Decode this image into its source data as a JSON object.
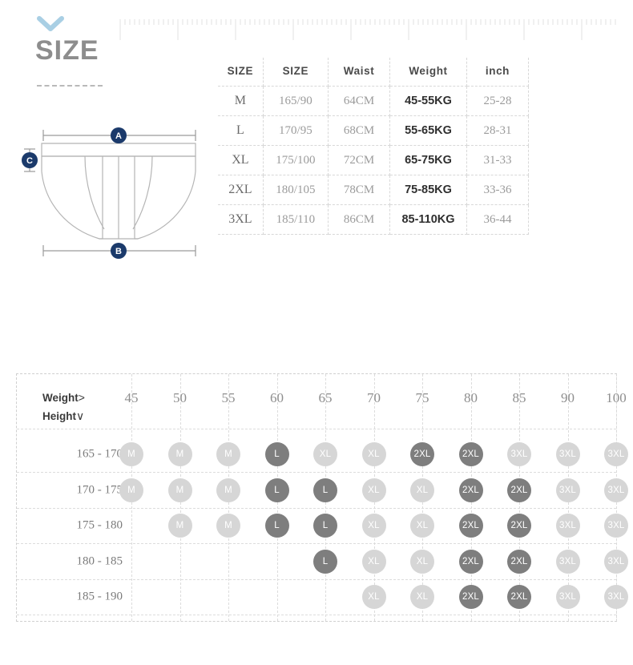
{
  "heading": {
    "title": "SIZE",
    "chevron_icon": "chevron-down-icon",
    "chevron_color": "#a9cfe4"
  },
  "diagram": {
    "name": "briefs-measurement-diagram",
    "badges": [
      {
        "id": "A",
        "label": "A",
        "position": "top-width"
      },
      {
        "id": "B",
        "label": "B",
        "position": "bottom-width"
      },
      {
        "id": "C",
        "label": "C",
        "position": "left-waistband-height"
      }
    ],
    "badge_color": "#1b3a6b",
    "outline_color": "#b9b9b9"
  },
  "spec_table": {
    "headers": [
      "SIZE",
      "SIZE",
      "Waist",
      "Weight",
      "inch"
    ],
    "rows": [
      {
        "size": "M",
        "size2": "165/90",
        "waist": "64CM",
        "weight": "45-55KG",
        "inch": "25-28"
      },
      {
        "size": "L",
        "size2": "170/95",
        "waist": "68CM",
        "weight": "55-65KG",
        "inch": "28-31"
      },
      {
        "size": "XL",
        "size2": "175/100",
        "waist": "72CM",
        "weight": "65-75KG",
        "inch": "31-33"
      },
      {
        "size": "2XL",
        "size2": "180/105",
        "waist": "78CM",
        "weight": "75-85KG",
        "inch": "33-36"
      },
      {
        "size": "3XL",
        "size2": "185/110",
        "waist": "86CM",
        "weight": "85-110KG",
        "inch": "36-44"
      }
    ]
  },
  "matrix": {
    "corner_label_top": "Weight",
    "corner_label_top_arrow": ">",
    "corner_label_bottom": "Height",
    "corner_label_bottom_arrow": "∨",
    "columns": [
      "45",
      "50",
      "55",
      "60",
      "65",
      "70",
      "75",
      "80",
      "85",
      "90",
      "100"
    ],
    "rows": [
      {
        "label": "165 - 170",
        "cells": [
          {
            "col": "45",
            "size": "M",
            "tone": "light"
          },
          {
            "col": "50",
            "size": "M",
            "tone": "light"
          },
          {
            "col": "55",
            "size": "M",
            "tone": "light"
          },
          {
            "col": "60",
            "size": "L",
            "tone": "dark"
          },
          {
            "col": "65",
            "size": "XL",
            "tone": "light"
          },
          {
            "col": "70",
            "size": "XL",
            "tone": "light"
          },
          {
            "col": "75",
            "size": "2XL",
            "tone": "dark"
          },
          {
            "col": "80",
            "size": "2XL",
            "tone": "dark"
          },
          {
            "col": "85",
            "size": "3XL",
            "tone": "light"
          },
          {
            "col": "90",
            "size": "3XL",
            "tone": "light"
          },
          {
            "col": "100",
            "size": "3XL",
            "tone": "light"
          }
        ]
      },
      {
        "label": "170 - 175",
        "cells": [
          {
            "col": "45",
            "size": "M",
            "tone": "light"
          },
          {
            "col": "50",
            "size": "M",
            "tone": "light"
          },
          {
            "col": "55",
            "size": "M",
            "tone": "light"
          },
          {
            "col": "60",
            "size": "L",
            "tone": "dark"
          },
          {
            "col": "65",
            "size": "L",
            "tone": "dark"
          },
          {
            "col": "70",
            "size": "XL",
            "tone": "light"
          },
          {
            "col": "75",
            "size": "XL",
            "tone": "light"
          },
          {
            "col": "80",
            "size": "2XL",
            "tone": "dark"
          },
          {
            "col": "85",
            "size": "2XL",
            "tone": "dark"
          },
          {
            "col": "90",
            "size": "3XL",
            "tone": "light"
          },
          {
            "col": "100",
            "size": "3XL",
            "tone": "light"
          }
        ]
      },
      {
        "label": "175 - 180",
        "cells": [
          {
            "col": "50",
            "size": "M",
            "tone": "light"
          },
          {
            "col": "55",
            "size": "M",
            "tone": "light"
          },
          {
            "col": "60",
            "size": "L",
            "tone": "dark"
          },
          {
            "col": "65",
            "size": "L",
            "tone": "dark"
          },
          {
            "col": "70",
            "size": "XL",
            "tone": "light"
          },
          {
            "col": "75",
            "size": "XL",
            "tone": "light"
          },
          {
            "col": "80",
            "size": "2XL",
            "tone": "dark"
          },
          {
            "col": "85",
            "size": "2XL",
            "tone": "dark"
          },
          {
            "col": "90",
            "size": "3XL",
            "tone": "light"
          },
          {
            "col": "100",
            "size": "3XL",
            "tone": "light"
          }
        ]
      },
      {
        "label": "180 - 185",
        "cells": [
          {
            "col": "65",
            "size": "L",
            "tone": "dark"
          },
          {
            "col": "70",
            "size": "XL",
            "tone": "light"
          },
          {
            "col": "75",
            "size": "XL",
            "tone": "light"
          },
          {
            "col": "80",
            "size": "2XL",
            "tone": "dark"
          },
          {
            "col": "85",
            "size": "2XL",
            "tone": "dark"
          },
          {
            "col": "90",
            "size": "3XL",
            "tone": "light"
          },
          {
            "col": "100",
            "size": "3XL",
            "tone": "light"
          }
        ]
      },
      {
        "label": "185 - 190",
        "cells": [
          {
            "col": "70",
            "size": "XL",
            "tone": "light"
          },
          {
            "col": "75",
            "size": "XL",
            "tone": "light"
          },
          {
            "col": "80",
            "size": "2XL",
            "tone": "dark"
          },
          {
            "col": "85",
            "size": "2XL",
            "tone": "dark"
          },
          {
            "col": "90",
            "size": "3XL",
            "tone": "light"
          },
          {
            "col": "100",
            "size": "3XL",
            "tone": "light"
          }
        ]
      }
    ],
    "tone_colors": {
      "light": "#d6d6d6",
      "dark": "#7e7e7e"
    }
  }
}
